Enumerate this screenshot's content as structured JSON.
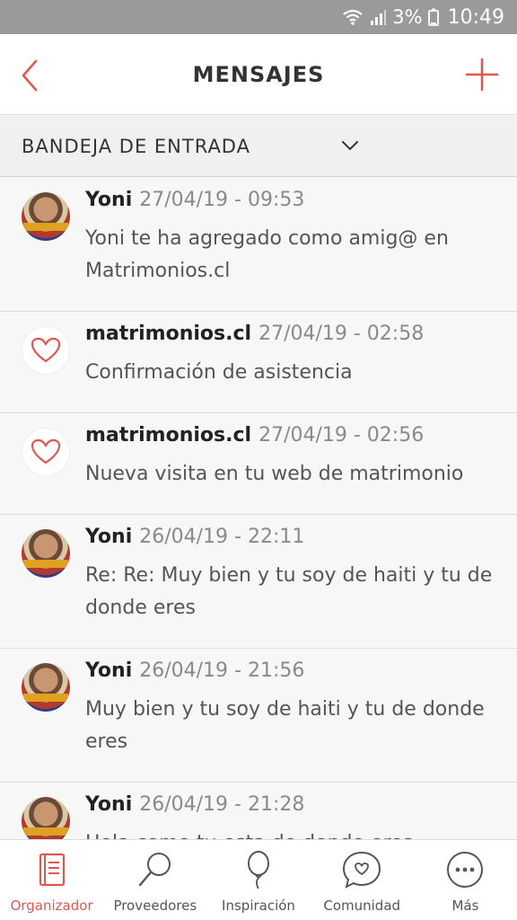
{
  "status_bar": {
    "battery": "3%",
    "time": "10:49",
    "wifi_icon": "wifi-icon",
    "signal_icon": "signal-icon",
    "battery_icon": "battery-icon"
  },
  "header": {
    "title": "MENSAJES",
    "back_icon": "back-chevron-icon",
    "add_icon": "plus-icon"
  },
  "inbox": {
    "label": "BANDEJA DE ENTRADA"
  },
  "messages": [
    {
      "sender": "Yoni",
      "date": "27/04/19 - 09:53",
      "body": "Yoni te ha agregado como amig@ en Matrimonios.cl",
      "avatar": "photo"
    },
    {
      "sender": "matrimonios.cl",
      "date": "27/04/19 - 02:58",
      "body": "Confirmación de asistencia",
      "avatar": "heart-logo"
    },
    {
      "sender": "matrimonios.cl",
      "date": "27/04/19 - 02:56",
      "body": "Nueva visita en tu web de matrimonio",
      "avatar": "heart-logo"
    },
    {
      "sender": "Yoni",
      "date": "26/04/19 - 22:11",
      "body": "Re: Re: Muy bien y tu soy de haiti y tu de donde eres",
      "avatar": "photo"
    },
    {
      "sender": "Yoni",
      "date": "26/04/19 - 21:56",
      "body": "Muy bien y tu soy de haiti y tu de donde eres",
      "avatar": "photo"
    },
    {
      "sender": "Yoni",
      "date": "26/04/19 - 21:28",
      "body": "Hola como tu esta de donde eres",
      "avatar": "photo"
    }
  ],
  "nav": [
    {
      "label": "Organizador",
      "icon": "notebook-icon",
      "active": true
    },
    {
      "label": "Proveedores",
      "icon": "magnifier-icon",
      "active": false
    },
    {
      "label": "Inspiración",
      "icon": "balloon-icon",
      "active": false
    },
    {
      "label": "Comunidad",
      "icon": "chat-heart-icon",
      "active": false
    },
    {
      "label": "Más",
      "icon": "more-icon",
      "active": false
    }
  ],
  "colors": {
    "accent": "#e0574f",
    "status_bar": "#9a9a9a",
    "list_bg": "#f7f7f7"
  }
}
